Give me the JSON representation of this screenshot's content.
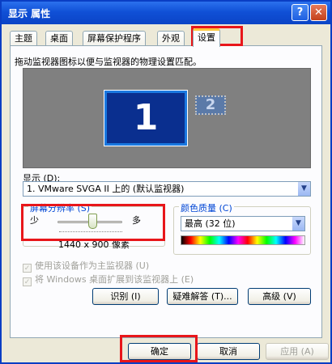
{
  "window": {
    "title": "显示 属性",
    "help": "?",
    "close": "✕"
  },
  "tabs": [
    {
      "label": "主题"
    },
    {
      "label": "桌面"
    },
    {
      "label": "屏幕保护程序"
    },
    {
      "label": "外观"
    },
    {
      "label": "设置"
    }
  ],
  "settings": {
    "caption": "拖动监视器图标以便与监视器的物理设置匹配。",
    "monitor1": "1",
    "monitor2": "2",
    "display_label": "显示 (D):",
    "display_value": "1. VMware SVGA II 上的 (默认监视器)",
    "resolution_label": "屏幕分辨率 (S)",
    "resolution_less": "少",
    "resolution_more": "多",
    "resolution_value": "1440 x 900 像素",
    "color_label": "颜色质量 (C)",
    "color_value": "最高 (32 位)",
    "primary_checkbox": "使用该设备作为主监视器 (U)",
    "extend_checkbox": "将 Windows 桌面扩展到该监视器上 (E)",
    "identify_button": "识别 (I)",
    "troubleshoot_button": "疑难解答 (T)...",
    "advanced_button": "高级 (V)"
  },
  "footer": {
    "ok": "确定",
    "cancel": "取消",
    "apply": "应用 (A)"
  },
  "colors": {
    "title_bar": "#0b44c6",
    "highlight_box": "#e8161a",
    "group_label": "#0046d5"
  }
}
